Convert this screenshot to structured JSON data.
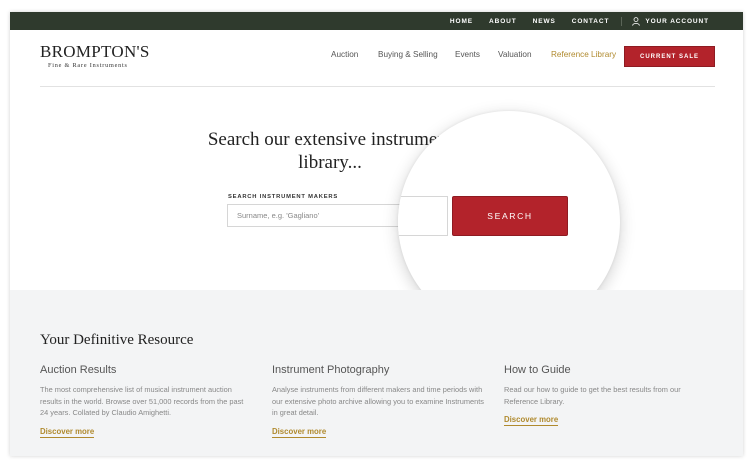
{
  "topbar": {
    "links": [
      "HOME",
      "ABOUT",
      "NEWS",
      "CONTACT"
    ],
    "account": "YOUR ACCOUNT"
  },
  "logo": {
    "main": "BROMPTON'S",
    "sub": "Fine & Rare Instruments"
  },
  "nav": {
    "items": [
      "Auction",
      "Buying & Selling",
      "Events",
      "Valuation",
      "Reference Library"
    ],
    "active": "Reference Library",
    "cta": "CURRENT SALE"
  },
  "hero": {
    "title_line1": "Search our extensive instrument",
    "title_line2": "library...",
    "field_label": "SEARCH INSTRUMENT MAKERS",
    "placeholder": "Surname, e.g. 'Gagliano'",
    "button": "SEARCH"
  },
  "resources": {
    "title": "Your Definitive Resource",
    "columns": [
      {
        "heading": "Auction Results",
        "text": "The most comprehensive list of musical instrument auction results in the world. Browse over 51,000 records from the past 24 years. Collated by Claudio Amighetti.",
        "link": "Discover more"
      },
      {
        "heading": "Instrument Photography",
        "text": "Analyse instruments from different makers and time periods with our extensive photo archive allowing you to examine Instruments in great detail.",
        "link": "Discover more"
      },
      {
        "heading": "How to Guide",
        "text": "Read our how to guide to get the best results from our Reference Library.",
        "link": "Discover more"
      }
    ]
  },
  "colors": {
    "topbar": "#2f3a2d",
    "accent_red": "#b3232b",
    "accent_gold": "#b08a2e",
    "section_grey": "#f3f4f5"
  },
  "icons": {
    "account": "user-icon"
  }
}
